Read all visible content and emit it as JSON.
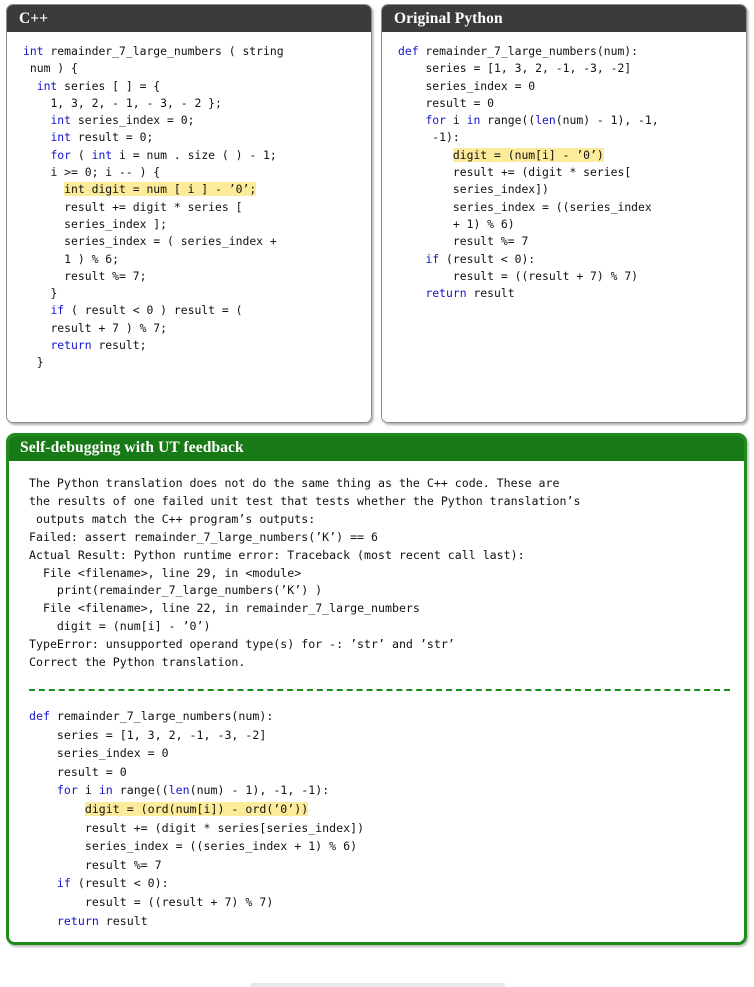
{
  "panels": {
    "cpp": {
      "title": "C++",
      "header_color": "#3b3b3b",
      "lines": [
        {
          "segments": [
            {
              "t": "int",
              "c": "kw"
            },
            {
              "t": " remainder_7_large_numbers ( string"
            }
          ]
        },
        {
          "segments": [
            {
              "t": " num ) {"
            }
          ]
        },
        {
          "segments": [
            {
              "t": "  "
            },
            {
              "t": "int",
              "c": "kw"
            },
            {
              "t": " series [ ] = {"
            }
          ]
        },
        {
          "segments": [
            {
              "t": "    1, 3, 2, - 1, - 3, - 2 };"
            }
          ]
        },
        {
          "segments": [
            {
              "t": "    "
            },
            {
              "t": "int",
              "c": "kw"
            },
            {
              "t": " series_index = 0;"
            }
          ]
        },
        {
          "segments": [
            {
              "t": "    "
            },
            {
              "t": "int",
              "c": "kw"
            },
            {
              "t": " result = 0;"
            }
          ]
        },
        {
          "segments": [
            {
              "t": "    "
            },
            {
              "t": "for",
              "c": "kw"
            },
            {
              "t": " ( "
            },
            {
              "t": "int",
              "c": "kw"
            },
            {
              "t": " i = num . size ( ) - 1;"
            }
          ]
        },
        {
          "segments": [
            {
              "t": "    i >= 0; i -- ) {"
            }
          ]
        },
        {
          "segments": [
            {
              "t": "      "
            },
            {
              "t": "int digit = num [ i ] - ’0’;",
              "c": "hl"
            }
          ],
          "highlight": true
        },
        {
          "segments": [
            {
              "t": "      result += digit * series ["
            }
          ]
        },
        {
          "segments": [
            {
              "t": "      series_index ];"
            }
          ]
        },
        {
          "segments": [
            {
              "t": "      series_index = ( series_index +"
            }
          ]
        },
        {
          "segments": [
            {
              "t": "      1 ) % 6;"
            }
          ]
        },
        {
          "segments": [
            {
              "t": "      result %= 7;"
            }
          ]
        },
        {
          "segments": [
            {
              "t": "    }"
            }
          ]
        },
        {
          "segments": [
            {
              "t": "    "
            },
            {
              "t": "if",
              "c": "kw"
            },
            {
              "t": " ( result < 0 ) result = ("
            }
          ]
        },
        {
          "segments": [
            {
              "t": "    result + 7 ) % 7;"
            }
          ]
        },
        {
          "segments": [
            {
              "t": "    "
            },
            {
              "t": "return",
              "c": "kw"
            },
            {
              "t": " result;"
            }
          ]
        },
        {
          "segments": [
            {
              "t": "  }"
            }
          ]
        }
      ]
    },
    "python": {
      "title": "Original Python",
      "header_color": "#3b3b3b",
      "lines": [
        {
          "segments": [
            {
              "t": "def",
              "c": "kw"
            },
            {
              "t": " remainder_7_large_numbers(num):"
            }
          ]
        },
        {
          "segments": [
            {
              "t": "    series = [1, 3, 2, -1, -3, -2]"
            }
          ]
        },
        {
          "segments": [
            {
              "t": "    series_index = 0"
            }
          ]
        },
        {
          "segments": [
            {
              "t": "    result = 0"
            }
          ]
        },
        {
          "segments": [
            {
              "t": "    "
            },
            {
              "t": "for",
              "c": "kw"
            },
            {
              "t": " i "
            },
            {
              "t": "in",
              "c": "kw"
            },
            {
              "t": " range(("
            },
            {
              "t": "len",
              "c": "kw"
            },
            {
              "t": "(num) - 1), -1,"
            }
          ]
        },
        {
          "segments": [
            {
              "t": "     -1):"
            }
          ]
        },
        {
          "segments": [
            {
              "t": "        "
            },
            {
              "t": "digit = (num[i] - ’0’)",
              "c": "hl"
            }
          ],
          "highlight": true
        },
        {
          "segments": [
            {
              "t": "        result += (digit * series["
            }
          ]
        },
        {
          "segments": [
            {
              "t": "        series_index])"
            }
          ]
        },
        {
          "segments": [
            {
              "t": "        series_index = ((series_index"
            }
          ]
        },
        {
          "segments": [
            {
              "t": "        + 1) % 6)"
            }
          ]
        },
        {
          "segments": [
            {
              "t": "        result %= 7"
            }
          ]
        },
        {
          "segments": [
            {
              "t": "    "
            },
            {
              "t": "if",
              "c": "kw"
            },
            {
              "t": " (result < 0):"
            }
          ]
        },
        {
          "segments": [
            {
              "t": "        result = ((result + 7) % 7)"
            }
          ]
        },
        {
          "segments": [
            {
              "t": "    "
            },
            {
              "t": "return",
              "c": "kw"
            },
            {
              "t": " result"
            }
          ]
        }
      ]
    },
    "feedback": {
      "title": "Self-debugging with UT feedback",
      "header_color": "#177a17",
      "border_color": "#1d8c1d",
      "message_lines": [
        "The Python translation does not do the same thing as the C++ code. These are",
        "the results of one failed unit test that tests whether the Python translation’s",
        " outputs match the C++ program’s outputs:",
        "Failed: assert remainder_7_large_numbers(’K’) == 6",
        "Actual Result: Python runtime error: Traceback (most recent call last):",
        "  File <filename>, line 29, in <module>",
        "    print(remainder_7_large_numbers(’K’) )",
        "  File <filename>, line 22, in remainder_7_large_numbers",
        "    digit = (num[i] - ’0’)",
        "TypeError: unsupported operand type(s) for -: ’str’ and ’str’",
        "Correct the Python translation."
      ],
      "fixed_code_lines": [
        {
          "segments": [
            {
              "t": "def",
              "c": "kw"
            },
            {
              "t": " remainder_7_large_numbers(num):"
            }
          ]
        },
        {
          "segments": [
            {
              "t": "    series = [1, 3, 2, -1, -3, -2]"
            }
          ]
        },
        {
          "segments": [
            {
              "t": "    series_index = 0"
            }
          ]
        },
        {
          "segments": [
            {
              "t": "    result = 0"
            }
          ]
        },
        {
          "segments": [
            {
              "t": "    "
            },
            {
              "t": "for",
              "c": "kw"
            },
            {
              "t": " i "
            },
            {
              "t": "in",
              "c": "kw"
            },
            {
              "t": " range(("
            },
            {
              "t": "len",
              "c": "kw"
            },
            {
              "t": "(num) - 1), -1, -1):"
            }
          ]
        },
        {
          "segments": [
            {
              "t": "        "
            },
            {
              "t": "digit = (ord(num[i]) - ord(’0’))",
              "c": "hl"
            }
          ],
          "highlight": true
        },
        {
          "segments": [
            {
              "t": "        result += (digit * series[series_index])"
            }
          ]
        },
        {
          "segments": [
            {
              "t": "        series_index = ((series_index + 1) % 6)"
            }
          ]
        },
        {
          "segments": [
            {
              "t": "        result %= 7"
            }
          ]
        },
        {
          "segments": [
            {
              "t": "    "
            },
            {
              "t": "if",
              "c": "kw"
            },
            {
              "t": " (result < 0):"
            }
          ]
        },
        {
          "segments": [
            {
              "t": "        result = ((result + 7) % 7)"
            }
          ]
        },
        {
          "segments": [
            {
              "t": "    "
            },
            {
              "t": "return",
              "c": "kw"
            },
            {
              "t": " result"
            }
          ]
        }
      ]
    }
  },
  "colors": {
    "keyword": "#1414cf",
    "highlight": "#fdeb9c",
    "header_gray": "#3b3b3b",
    "header_green": "#177a17",
    "green_border": "#1d8c1d"
  }
}
